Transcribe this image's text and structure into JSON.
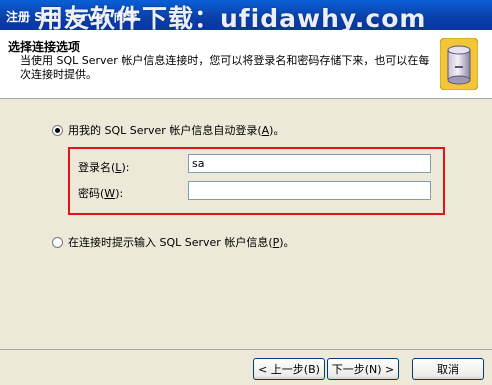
{
  "window": {
    "title": "注册 SQL Server 向导",
    "watermark": "用友软件下载：ufidawhy.com"
  },
  "header": {
    "title": "选择连接选项",
    "description": "当使用 SQL Server 帐户信息连接时，您可以将登录名和密码存储下来，也可以在每次连接时提供。",
    "icon": "sql-server-icon"
  },
  "options": {
    "auto_login": {
      "label_prefix": "用我的 SQL Server 帐户信息自动登录(",
      "hotkey": "A",
      "label_suffix": ")。",
      "checked": true
    },
    "prompt_login": {
      "label_prefix": "在连接时提示输入 SQL Server 帐户信息(",
      "hotkey": "P",
      "label_suffix": ")。",
      "checked": false
    }
  },
  "credentials": {
    "highlight_color": "#e0151c",
    "login": {
      "label_prefix": "登录名(",
      "hotkey": "L",
      "label_suffix": "):",
      "value": "sa"
    },
    "password": {
      "label_prefix": "密码(",
      "hotkey": "W",
      "label_suffix": "):",
      "value": ""
    }
  },
  "buttons": {
    "back": "< 上一步(B)",
    "next": "下一步(N) >",
    "cancel": "取消"
  }
}
